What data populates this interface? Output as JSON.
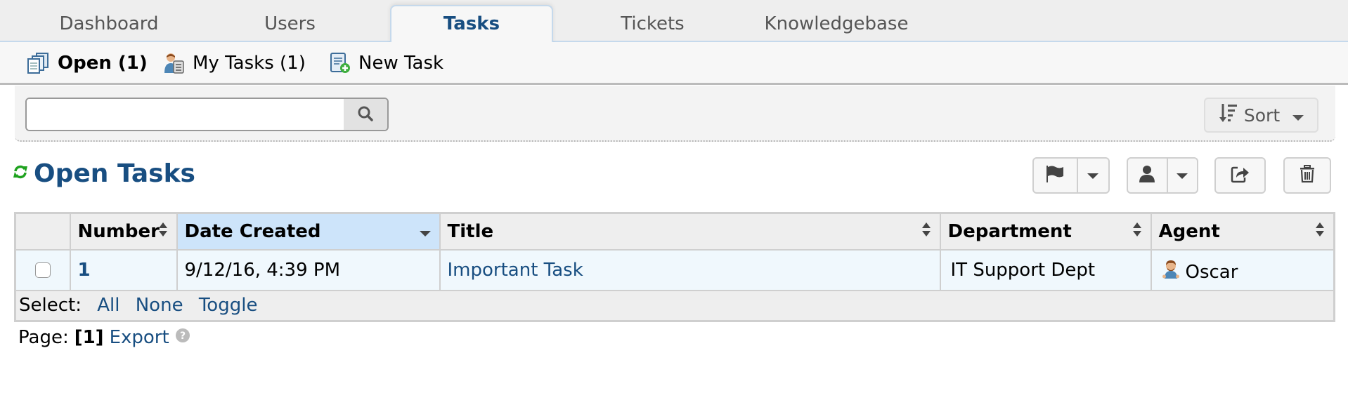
{
  "top_nav": {
    "tabs": [
      {
        "label": "Dashboard",
        "active": false
      },
      {
        "label": "Users",
        "active": false
      },
      {
        "label": "Tasks",
        "active": true
      },
      {
        "label": "Tickets",
        "active": false
      },
      {
        "label": "Knowledgebase",
        "active": false
      }
    ]
  },
  "sub_nav": {
    "items": [
      {
        "label": "Open (1)",
        "icon": "open-tasks-icon",
        "active": true
      },
      {
        "label": "My Tasks (1)",
        "icon": "my-tasks-icon",
        "active": false
      },
      {
        "label": "New Task",
        "icon": "new-task-icon",
        "active": false
      }
    ]
  },
  "filter_bar": {
    "search_value": "",
    "search_placeholder": "",
    "sort_label": "Sort"
  },
  "page": {
    "title": "Open Tasks"
  },
  "table": {
    "columns": [
      {
        "label": "",
        "sortable": false
      },
      {
        "label": "Number",
        "sortable": true
      },
      {
        "label": "Date Created",
        "sortable": true,
        "sorted": "desc"
      },
      {
        "label": "Title",
        "sortable": true
      },
      {
        "label": "Department",
        "sortable": true
      },
      {
        "label": "Agent",
        "sortable": true
      }
    ],
    "rows": [
      {
        "checked": false,
        "number": "1",
        "date_created": "9/12/16, 4:39 PM",
        "title": "Important Task",
        "department": "IT Support Dept",
        "agent": "Oscar"
      }
    ],
    "select": {
      "label": "Select:",
      "all": "All",
      "none": "None",
      "toggle": "Toggle"
    }
  },
  "pager": {
    "label": "Page:",
    "current": "[1]",
    "export": "Export"
  },
  "colors": {
    "brand_blue": "#184e81",
    "refresh_green": "#1fa21f",
    "sorted_header": "#cde4fa",
    "row_bg": "#f0f8fd"
  }
}
